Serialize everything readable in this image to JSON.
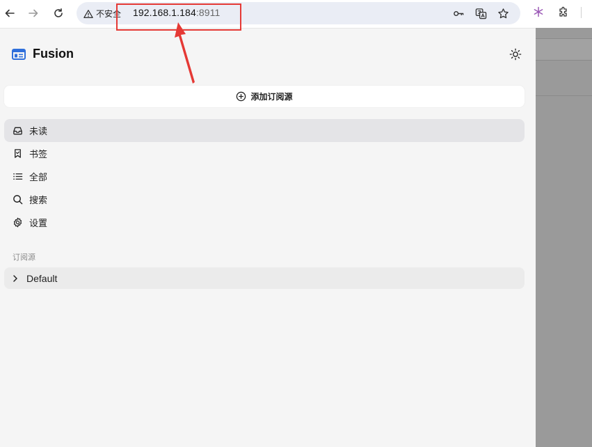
{
  "browser": {
    "security_label": "不安全",
    "url_host": "192.168.1.184",
    "url_port": ":8911",
    "icons": [
      "back-arrow-icon",
      "forward-arrow-icon",
      "reload-icon",
      "warning-icon",
      "key-icon",
      "translate-icon",
      "star-icon",
      "snowflake-icon",
      "puzzle-icon"
    ],
    "colors": {
      "omnibox_bg": "#eaedf5",
      "extension_accent": "#9b59b6"
    }
  },
  "app": {
    "title": "Fusion",
    "accent_color": "#2f6fdb",
    "add_feed_label": "添加订阅源",
    "nav": [
      {
        "label": "未读",
        "icon": "inbox-icon",
        "active": true
      },
      {
        "label": "书签",
        "icon": "bookmark-icon",
        "active": false
      },
      {
        "label": "全部",
        "icon": "list-icon",
        "active": false
      },
      {
        "label": "搜索",
        "icon": "search-icon",
        "active": false
      },
      {
        "label": "设置",
        "icon": "settings-gear-icon",
        "active": false
      }
    ],
    "section_label": "订阅源",
    "groups": [
      {
        "label": "Default",
        "icon": "chevron-right-icon"
      }
    ]
  },
  "annotation": {
    "color": "#e53935"
  }
}
